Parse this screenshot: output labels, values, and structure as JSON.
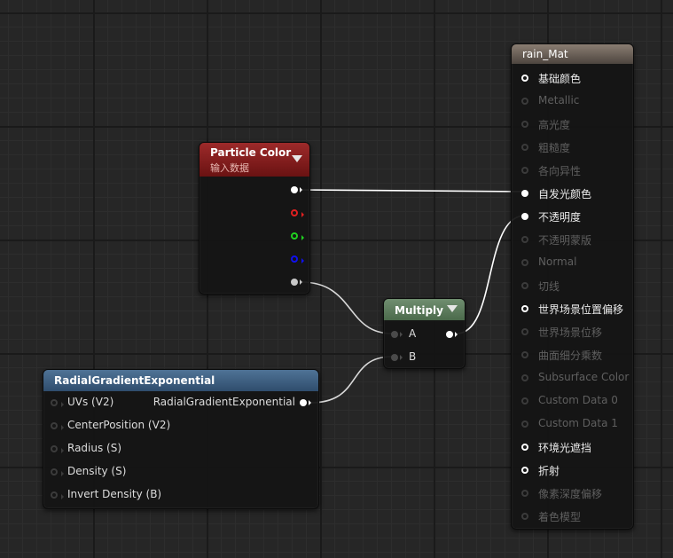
{
  "nodes": {
    "particle_color": {
      "title": "Particle Color",
      "subtitle": "输入数据",
      "header_color": "#8a1c1c"
    },
    "multiply": {
      "title": "Multiply",
      "header_color": "#5e7a5e",
      "inputs": [
        "A",
        "B"
      ]
    },
    "radial": {
      "title": "RadialGradientExponential",
      "header_color": "#3c5f82",
      "inputs": [
        "UVs (V2)",
        "CenterPosition (V2)",
        "Radius (S)",
        "Density (S)",
        "Invert Density (B)"
      ],
      "output": "RadialGradientExponential"
    },
    "material": {
      "title": "rain_Mat",
      "header_color": "#6e645c",
      "pins": [
        {
          "label": "基础颜色",
          "active": true
        },
        {
          "label": "Metallic",
          "active": false
        },
        {
          "label": "高光度",
          "active": false
        },
        {
          "label": "粗糙度",
          "active": false
        },
        {
          "label": "各向异性",
          "active": false
        },
        {
          "label": "自发光颜色",
          "active": true,
          "connected": true
        },
        {
          "label": "不透明度",
          "active": true,
          "connected": true
        },
        {
          "label": "不透明蒙版",
          "active": false
        },
        {
          "label": "Normal",
          "active": false
        },
        {
          "label": "切线",
          "active": false
        },
        {
          "label": "世界场景位置偏移",
          "active": true
        },
        {
          "label": "世界场景位移",
          "active": false
        },
        {
          "label": "曲面细分乘数",
          "active": false
        },
        {
          "label": "Subsurface Color",
          "active": false
        },
        {
          "label": "Custom Data 0",
          "active": false
        },
        {
          "label": "Custom Data 1",
          "active": false
        },
        {
          "label": "环境光遮挡",
          "active": true
        },
        {
          "label": "折射",
          "active": true
        },
        {
          "label": "像素深度偏移",
          "active": false
        },
        {
          "label": "着色模型",
          "active": false
        }
      ]
    }
  }
}
